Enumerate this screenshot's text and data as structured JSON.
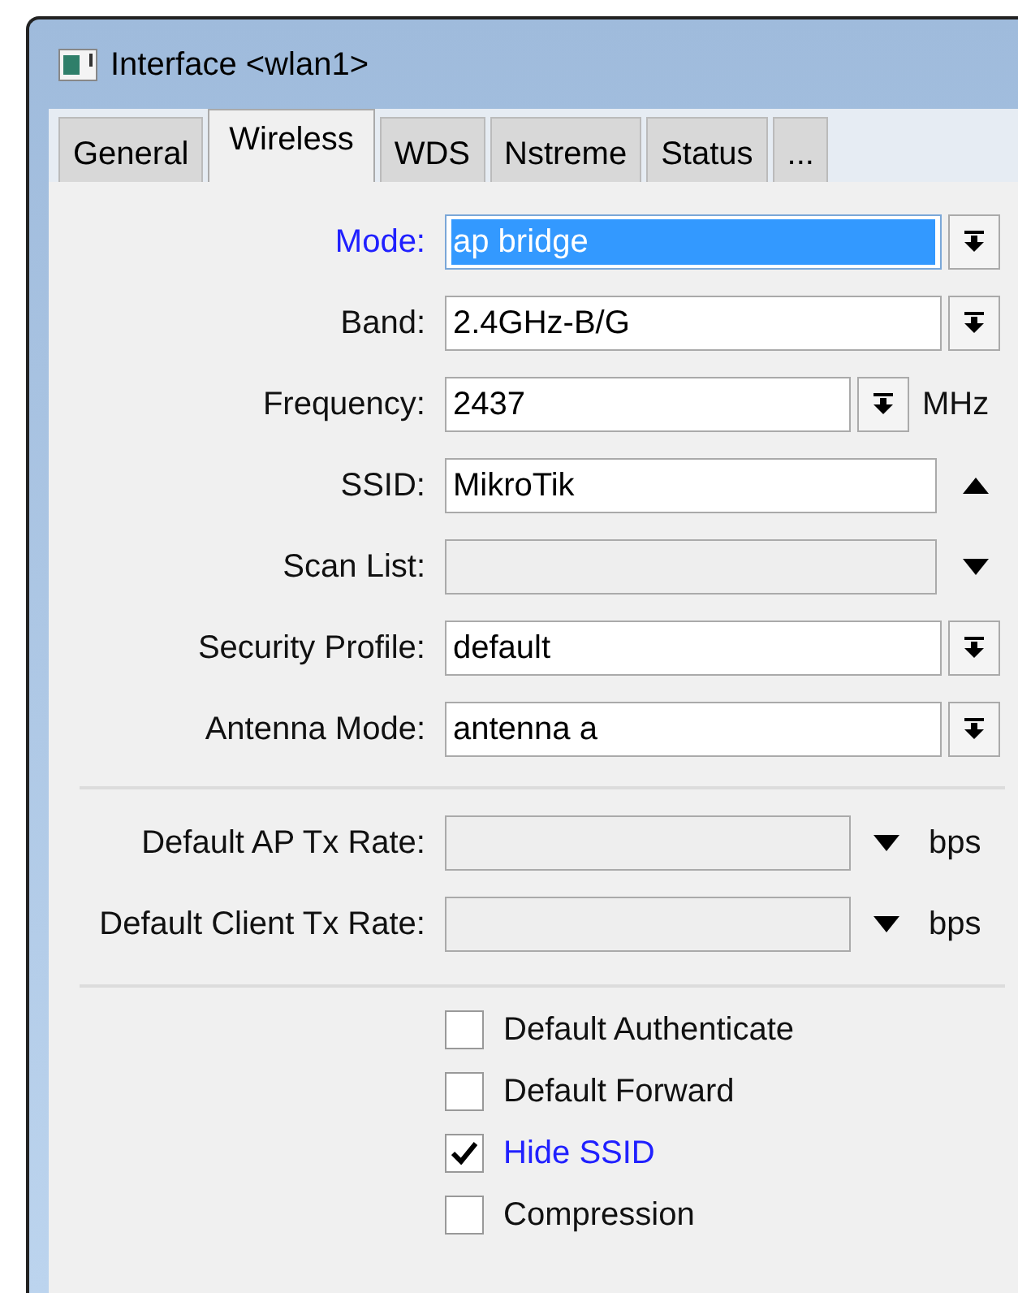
{
  "window": {
    "title": "Interface <wlan1>"
  },
  "tabs": [
    {
      "label": "General",
      "selected": false
    },
    {
      "label": "Wireless",
      "selected": true
    },
    {
      "label": "WDS",
      "selected": false
    },
    {
      "label": "Nstreme",
      "selected": false
    },
    {
      "label": "Status",
      "selected": false
    },
    {
      "label": "...",
      "selected": false
    }
  ],
  "sections": [
    {
      "fields": [
        {
          "label": "Mode:",
          "value": "ap bridge",
          "kind": "select",
          "modified": true,
          "selected": true
        },
        {
          "label": "Band:",
          "value": "2.4GHz-B/G",
          "kind": "select",
          "modified": false,
          "selected": false
        },
        {
          "label": "Frequency:",
          "value": "2437",
          "kind": "select",
          "unit": "MHz",
          "modified": false,
          "selected": false
        },
        {
          "label": "SSID:",
          "value": "MikroTik",
          "kind": "toggle",
          "expanded": true,
          "modified": false,
          "selected": false
        },
        {
          "label": "Scan List:",
          "kind": "toggle",
          "expanded": false,
          "disabled": true,
          "modified": false,
          "selected": false
        },
        {
          "label": "Security Profile:",
          "value": "default",
          "kind": "select",
          "modified": false,
          "selected": false
        },
        {
          "label": "Antenna Mode:",
          "value": "antenna a",
          "kind": "select",
          "modified": false,
          "selected": false
        }
      ]
    },
    {
      "fields": [
        {
          "label": "Default AP Tx Rate:",
          "kind": "toggle",
          "expanded": false,
          "disabled": true,
          "unit": "bps",
          "modified": false,
          "selected": false
        },
        {
          "label": "Default Client Tx Rate:",
          "kind": "toggle",
          "expanded": false,
          "disabled": true,
          "unit": "bps",
          "modified": false,
          "selected": false
        }
      ]
    }
  ],
  "checkboxes": [
    {
      "label": "Default Authenticate",
      "checked": false,
      "modified": false
    },
    {
      "label": "Default Forward",
      "checked": false,
      "modified": false
    },
    {
      "label": "Hide SSID",
      "checked": true,
      "modified": true
    },
    {
      "label": "Compression",
      "checked": false,
      "modified": false
    }
  ]
}
